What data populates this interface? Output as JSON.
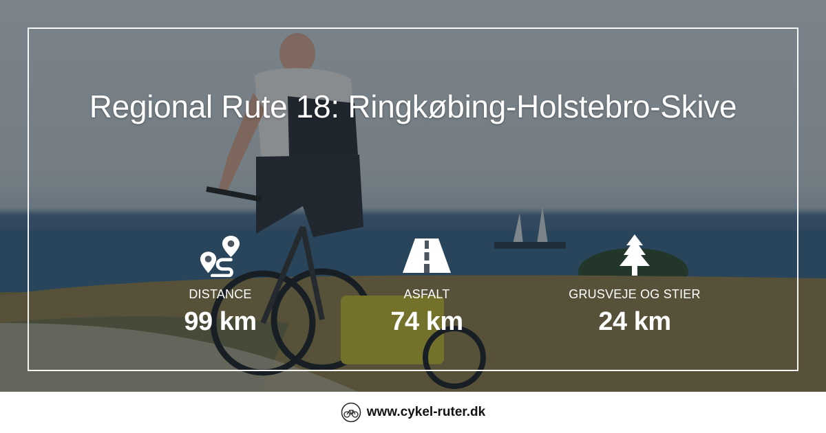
{
  "title": "Regional Rute 18: Ringkøbing-Holstebro-Skive",
  "stats": [
    {
      "icon": "route-pin-icon",
      "label": "DISTANCE",
      "value": "99 km"
    },
    {
      "icon": "road-icon",
      "label": "ASFALT",
      "value": "74 km"
    },
    {
      "icon": "pine-tree-icon",
      "label": "GRUSVEJE OG STIER",
      "value": "24 km"
    }
  ],
  "footer": {
    "logo_icon": "bicycle-logo-icon",
    "url": "www.cykel-ruter.dk"
  },
  "colors": {
    "text": "#ffffff",
    "footer_text": "#111111",
    "overlay": "rgba(20,30,40,0.45)"
  }
}
